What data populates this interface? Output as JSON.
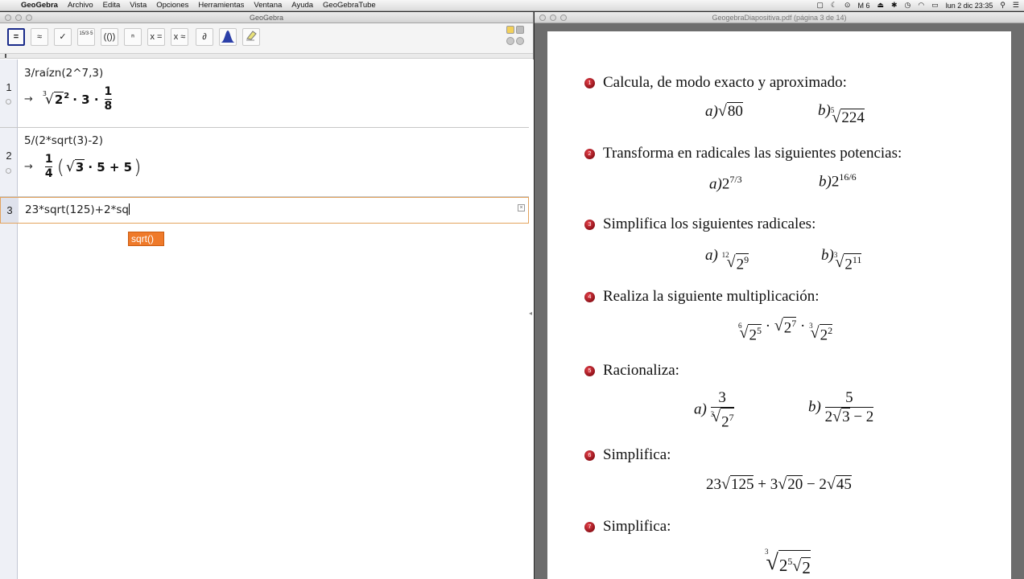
{
  "menubar": {
    "app": "GeoGebra",
    "items": [
      "Archivo",
      "Edita",
      "Vista",
      "Opciones",
      "Herramientas",
      "Ventana",
      "Ayuda",
      "GeoGebraTube"
    ],
    "status_battery": "6",
    "clock": "lun 2 dic  23:35"
  },
  "geogebra": {
    "window_title": "GeoGebra",
    "tools": [
      "=",
      "≈",
      "✓",
      "15/3·5",
      "(())",
      "ⁿ",
      "x =",
      "x ≈",
      "∂",
      "",
      ""
    ],
    "rows": [
      {
        "num": "1",
        "input": "3/raízn(2^7,3)"
      },
      {
        "num": "2",
        "input": "5/(2*sqrt(3)-2)"
      },
      {
        "num": "3",
        "input_before_caret": "23*sqrt(125)+2*sq",
        "input_after_caret": ""
      }
    ],
    "row1_output": {
      "arrow": "→",
      "root_index": "3",
      "radicand": "2",
      "exp": "2",
      "mid": "· 3 ·",
      "frac_num": "1",
      "frac_den": "8"
    },
    "row2_output": {
      "arrow": "→",
      "frac_num": "1",
      "frac_den": "4",
      "radicand": "3",
      "rest": "· 5 + 5"
    },
    "suggestion": "sqrt()"
  },
  "pdf": {
    "window_title": "GeogebraDiapositiva.pdf (página 3 de 14)",
    "exercises": [
      {
        "n": "1",
        "text": "Calcula, de modo exacto y aproximado:"
      },
      {
        "n": "2",
        "text": "Transforma en radicales las siguientes potencias:"
      },
      {
        "n": "3",
        "text": "Simplifica los siguientes radicales:"
      },
      {
        "n": "4",
        "text": "Realiza la siguiente multiplicación:"
      },
      {
        "n": "5",
        "text": "Racionaliza:"
      },
      {
        "n": "6",
        "text": "Simplifica:"
      },
      {
        "n": "7",
        "text": "Simplifica:"
      }
    ],
    "labels": {
      "a": "a)",
      "b": "b)"
    }
  }
}
